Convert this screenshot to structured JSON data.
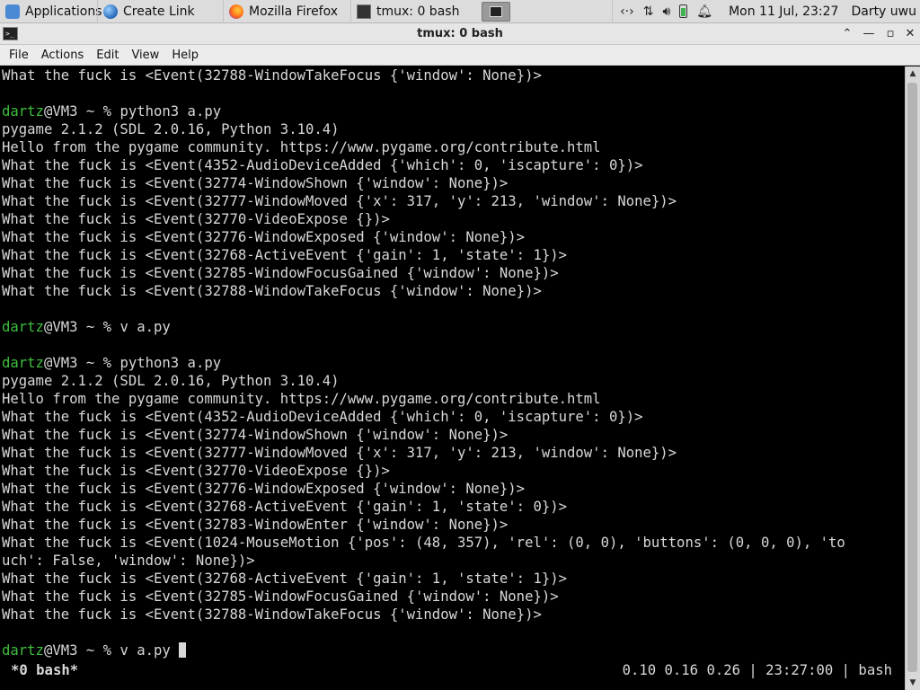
{
  "panel": {
    "applications": "Applications",
    "tasks": [
      {
        "label": "Create Link"
      },
      {
        "label": "Mozilla Firefox"
      },
      {
        "label": "tmux: 0 bash"
      }
    ],
    "clock": "Mon 11 Jul, 23:27",
    "user": "Darty uwu"
  },
  "window": {
    "title": "tmux: 0 bash"
  },
  "menu": [
    "File",
    "Actions",
    "Edit",
    "View",
    "Help"
  ],
  "terminal": {
    "lines": [
      {
        "t": "What the fuck is <Event(32788-WindowTakeFocus {'window': None})>"
      },
      {
        "t": ""
      },
      {
        "u": "dartz",
        "t": "@VM3 ~ % python3 a.py"
      },
      {
        "t": "pygame 2.1.2 (SDL 2.0.16, Python 3.10.4)"
      },
      {
        "t": "Hello from the pygame community. https://www.pygame.org/contribute.html"
      },
      {
        "t": "What the fuck is <Event(4352-AudioDeviceAdded {'which': 0, 'iscapture': 0})>"
      },
      {
        "t": "What the fuck is <Event(32774-WindowShown {'window': None})>"
      },
      {
        "t": "What the fuck is <Event(32777-WindowMoved {'x': 317, 'y': 213, 'window': None})>"
      },
      {
        "t": "What the fuck is <Event(32770-VideoExpose {})>"
      },
      {
        "t": "What the fuck is <Event(32776-WindowExposed {'window': None})>"
      },
      {
        "t": "What the fuck is <Event(32768-ActiveEvent {'gain': 1, 'state': 1})>"
      },
      {
        "t": "What the fuck is <Event(32785-WindowFocusGained {'window': None})>"
      },
      {
        "t": "What the fuck is <Event(32788-WindowTakeFocus {'window': None})>"
      },
      {
        "t": ""
      },
      {
        "u": "dartz",
        "t": "@VM3 ~ % v a.py"
      },
      {
        "t": ""
      },
      {
        "u": "dartz",
        "t": "@VM3 ~ % python3 a.py"
      },
      {
        "t": "pygame 2.1.2 (SDL 2.0.16, Python 3.10.4)"
      },
      {
        "t": "Hello from the pygame community. https://www.pygame.org/contribute.html"
      },
      {
        "t": "What the fuck is <Event(4352-AudioDeviceAdded {'which': 0, 'iscapture': 0})>"
      },
      {
        "t": "What the fuck is <Event(32774-WindowShown {'window': None})>"
      },
      {
        "t": "What the fuck is <Event(32777-WindowMoved {'x': 317, 'y': 213, 'window': None})>"
      },
      {
        "t": "What the fuck is <Event(32770-VideoExpose {})>"
      },
      {
        "t": "What the fuck is <Event(32776-WindowExposed {'window': None})>"
      },
      {
        "t": "What the fuck is <Event(32768-ActiveEvent {'gain': 1, 'state': 0})>"
      },
      {
        "t": "What the fuck is <Event(32783-WindowEnter {'window': None})>"
      },
      {
        "t": "What the fuck is <Event(1024-MouseMotion {'pos': (48, 357), 'rel': (0, 0), 'buttons': (0, 0, 0), 'to"
      },
      {
        "t": "uch': False, 'window': None})>"
      },
      {
        "t": "What the fuck is <Event(32768-ActiveEvent {'gain': 1, 'state': 1})>"
      },
      {
        "t": "What the fuck is <Event(32785-WindowFocusGained {'window': None})>"
      },
      {
        "t": "What the fuck is <Event(32788-WindowTakeFocus {'window': None})>"
      },
      {
        "t": ""
      },
      {
        "u": "dartz",
        "t": "@VM3 ~ % v a.py ",
        "cursor": true
      }
    ]
  },
  "status": {
    "left": "*0 bash*",
    "right": "0.10 0.16 0.26 | 23:27:00 | bash"
  },
  "colors": {
    "prompt_user": "#3fbf3f",
    "terminal_fg": "#d8d8d8",
    "terminal_bg": "#000000"
  }
}
